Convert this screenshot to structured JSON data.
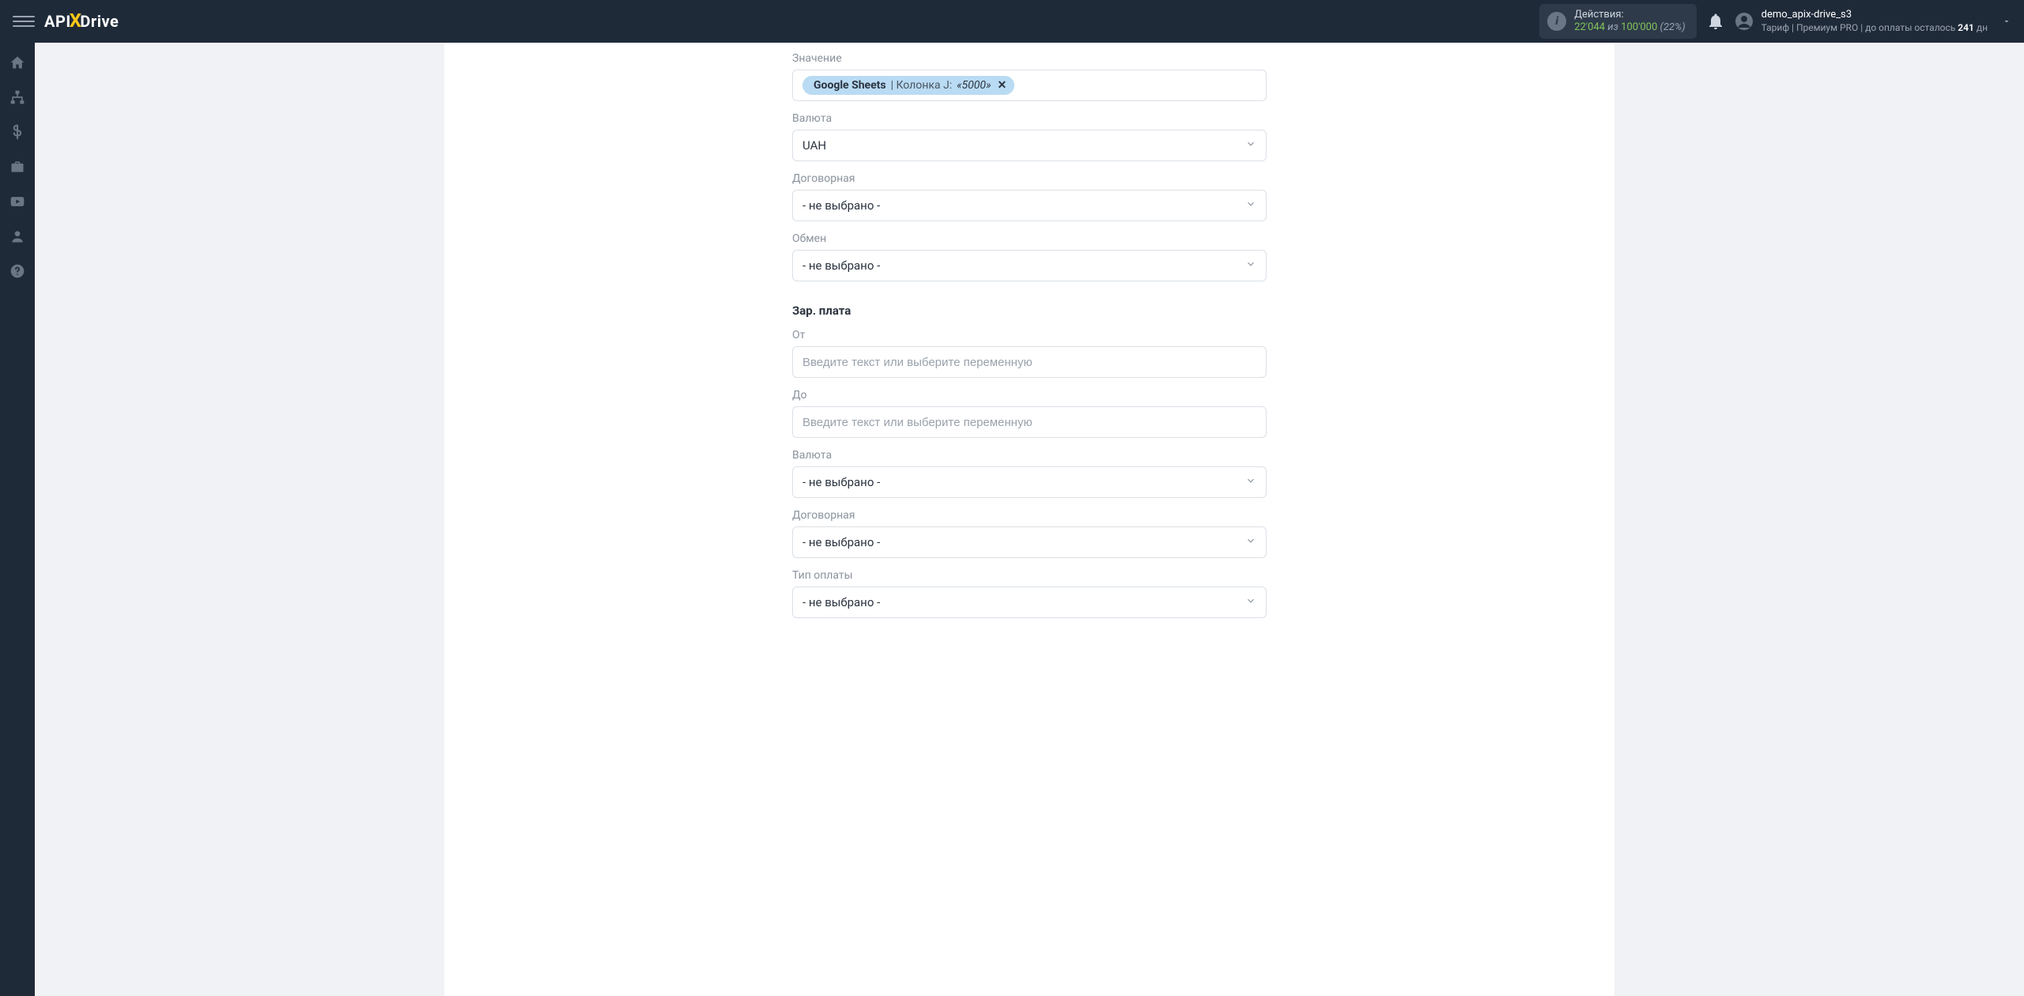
{
  "header": {
    "logo_pre": "API",
    "logo_x": "X",
    "logo_post": "Drive",
    "actions_label": "Действия:",
    "actions_used": "22'044",
    "actions_of": "из",
    "actions_total": "100'000",
    "actions_pct": "(22%)",
    "user_name": "demo_apix-drive_s3",
    "tariff_prefix": "Тариф |",
    "tariff_name": "Премиум PRO",
    "tariff_suffix": "| до оплаты осталось",
    "tariff_days": "241",
    "tariff_days_unit": "дн"
  },
  "form": {
    "value_label": "Значение",
    "chip_source": "Google Sheets",
    "chip_col_prefix": "| Колонка J:",
    "chip_col_value": "«5000»",
    "currency1_label": "Валюта",
    "currency1_value": "UAH",
    "nego1_label": "Договорная",
    "nego1_value": "- не выбрано -",
    "exchange_label": "Обмен",
    "exchange_value": "- не выбрано -",
    "salary_title": "Зар. плата",
    "from_label": "От",
    "from_placeholder": "Введите текст или выберите переменную",
    "to_label": "До",
    "to_placeholder": "Введите текст или выберите переменную",
    "currency2_label": "Валюта",
    "currency2_value": "- не выбрано -",
    "nego2_label": "Договорная",
    "nego2_value": "- не выбрано -",
    "paytype_label": "Тип оплаты",
    "paytype_value": "- не выбрано -"
  }
}
